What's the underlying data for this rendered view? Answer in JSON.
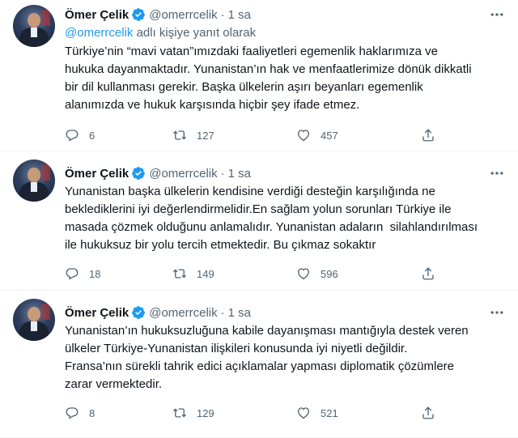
{
  "colors": {
    "accent": "#1d9bf0",
    "muted": "#536471",
    "text": "#0f1419",
    "divider": "#eff3f4"
  },
  "icons": {
    "verified": "verified-badge-icon",
    "more": "more-dots-icon",
    "reply": "reply-icon",
    "retweet": "retweet-icon",
    "like": "heart-icon",
    "share": "share-icon"
  },
  "tweets": [
    {
      "name": "Ömer Çelik",
      "handle": "@omerrcelik",
      "dot": "·",
      "time": "1 sa",
      "reply_mention": "@omerrcelik",
      "reply_suffix": " adlı kişiye yanıt olarak",
      "text": "Türkiye’nin “mavi vatan”ımızdaki faaliyetleri egemenlik haklarımıza ve\nhukuka dayanmaktadır. Yunanistan’ın hak ve menfaatlerimize dönük dikkatli\nbir dil kullanması gerekir. Başka ülkelerin aşırı beyanları egemenlik\nalanımızda ve hukuk karşısında hiçbir şey ifade etmez.",
      "replies": "6",
      "retweets": "127",
      "likes": "457"
    },
    {
      "name": "Ömer Çelik",
      "handle": "@omerrcelik",
      "dot": "·",
      "time": "1 sa",
      "text": "Yunanistan başka ülkelerin kendisine verdiği desteğin karşılığında ne\nbeklediklerini iyi değerlendirmelidir.En sağlam yolun sorunları Türkiye ile\nmasada çözmek olduğunu anlamalıdır. Yunanistan adaların  silahlandırılması\nile hukuksuz bir yolu tercih etmektedir. Bu çıkmaz sokaktır",
      "replies": "18",
      "retweets": "149",
      "likes": "596"
    },
    {
      "name": "Ömer Çelik",
      "handle": "@omerrcelik",
      "dot": "·",
      "time": "1 sa",
      "text": "Yunanistan’ın hukuksuzluğuna kabile dayanışması mantığıyla destek veren\nülkeler Türkiye-Yunanistan ilişkileri konusunda iyi niyetli değildir.\nFransa’nın sürekli tahrik edici açıklamalar yapması diplomatik çözümlere\nzarar vermektedir.",
      "replies": "8",
      "retweets": "129",
      "likes": "521"
    }
  ]
}
